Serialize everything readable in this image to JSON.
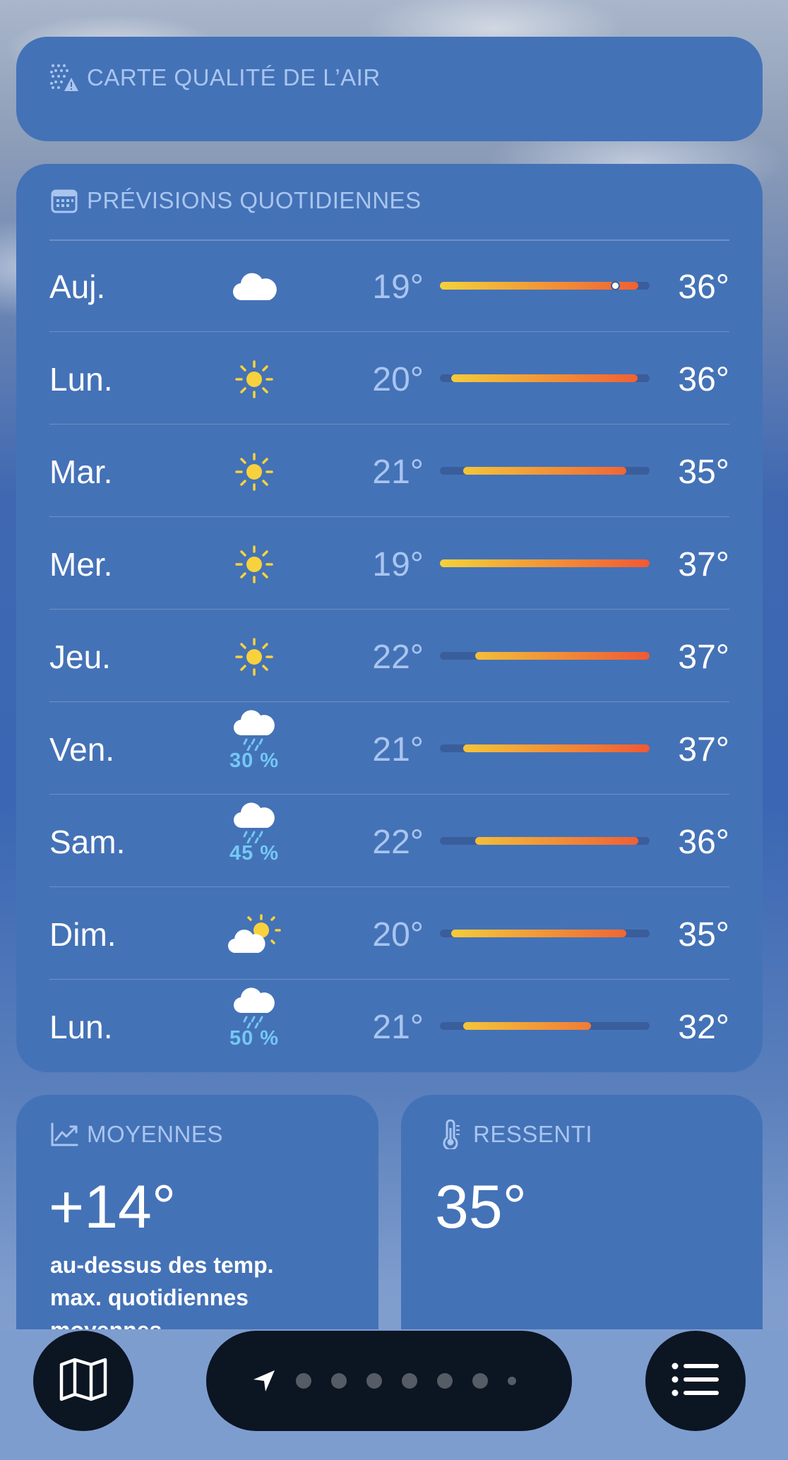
{
  "air_quality": {
    "title": "CARTE QUALITÉ DE L’AIR",
    "icon": "air-quality-map-icon"
  },
  "daily": {
    "title": "PRÉVISIONS QUOTIDIENNES",
    "icon": "calendar-icon",
    "range_min": 19,
    "range_max": 37,
    "days": [
      {
        "label": "Auj.",
        "icon": "cloud",
        "precip": "",
        "min_text": "19°",
        "max_text": "36°",
        "min": 19,
        "max": 36,
        "current": 34
      },
      {
        "label": "Lun.",
        "icon": "sun",
        "precip": "",
        "min_text": "20°",
        "max_text": "36°",
        "min": 20,
        "max": 36
      },
      {
        "label": "Mar.",
        "icon": "sun",
        "precip": "",
        "min_text": "21°",
        "max_text": "35°",
        "min": 21,
        "max": 35
      },
      {
        "label": "Mer.",
        "icon": "sun",
        "precip": "",
        "min_text": "19°",
        "max_text": "37°",
        "min": 19,
        "max": 37
      },
      {
        "label": "Jeu.",
        "icon": "sun",
        "precip": "",
        "min_text": "22°",
        "max_text": "37°",
        "min": 22,
        "max": 37
      },
      {
        "label": "Ven.",
        "icon": "rain",
        "precip": "30 %",
        "min_text": "21°",
        "max_text": "37°",
        "min": 21,
        "max": 37
      },
      {
        "label": "Sam.",
        "icon": "rain",
        "precip": "45 %",
        "min_text": "22°",
        "max_text": "36°",
        "min": 22,
        "max": 36
      },
      {
        "label": "Dim.",
        "icon": "partly-sunny",
        "precip": "",
        "min_text": "20°",
        "max_text": "35°",
        "min": 20,
        "max": 35
      },
      {
        "label": "Lun.",
        "icon": "rain",
        "precip": "50 %",
        "min_text": "21°",
        "max_text": "32°",
        "min": 21,
        "max": 32
      }
    ]
  },
  "averages": {
    "title": "MOYENNES",
    "icon": "trend-chart-icon",
    "value": "+14°",
    "description_lines": [
      "au-dessus des temp.",
      "max. quotidiennes",
      "moyennes"
    ]
  },
  "feels_like": {
    "title": "RESSENTI",
    "icon": "thermometer-icon",
    "value": "35°"
  },
  "bottom_bar": {
    "map_icon": "map-icon",
    "location_icon": "location-arrow-icon",
    "page_count": 6,
    "list_icon": "list-icon"
  }
}
